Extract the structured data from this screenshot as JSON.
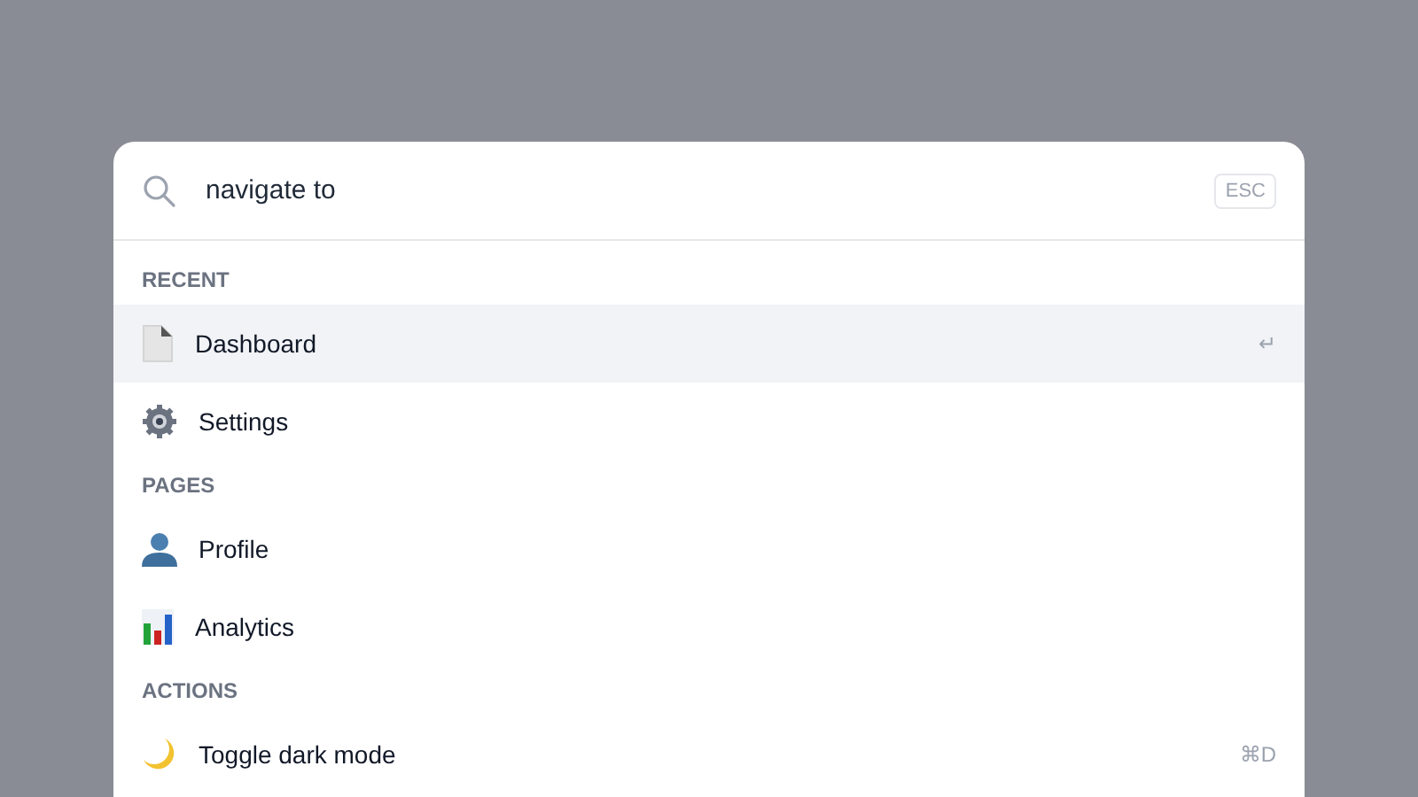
{
  "search": {
    "value": "navigate to",
    "esc_key": "ESC"
  },
  "groups": [
    {
      "label": "RECENT",
      "items": [
        {
          "label": "Dashboard",
          "selected": true,
          "shortcut": "↵"
        },
        {
          "label": "Settings",
          "selected": false
        }
      ]
    },
    {
      "label": "PAGES",
      "items": [
        {
          "label": "Profile",
          "selected": false
        },
        {
          "label": "Analytics",
          "selected": false
        }
      ]
    },
    {
      "label": "ACTIONS",
      "items": [
        {
          "label": "Toggle dark mode",
          "selected": false,
          "shortcut": "⌘D"
        }
      ]
    }
  ]
}
